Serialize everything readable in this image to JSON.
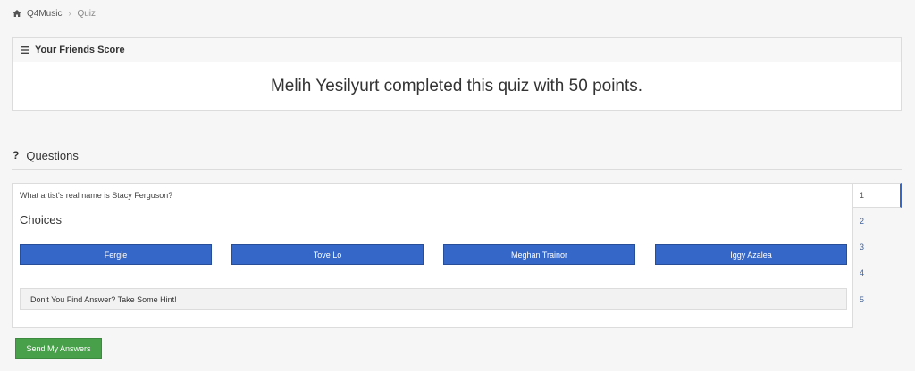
{
  "breadcrumb": {
    "home_label": "Q4Music",
    "separator": "›",
    "current_label": "Quiz"
  },
  "friends_score": {
    "header_title": "Your Friends Score",
    "message": "Melih Yesilyurt completed this quiz with 50 points."
  },
  "questions_section": {
    "icon_glyph": "?",
    "title": "Questions"
  },
  "question": {
    "text": "What artist's real name is Stacy Ferguson?",
    "choices_title": "Choices",
    "choices": [
      "Fergie",
      "Tove Lo",
      "Meghan Trainor",
      "Iggy Azalea"
    ],
    "hint_label": "Don't You Find Answer? Take Some Hint!"
  },
  "question_tabs": {
    "items": [
      "1",
      "2",
      "3",
      "4",
      "5"
    ],
    "active": "1"
  },
  "actions": {
    "send_label": "Send My Answers"
  },
  "colors": {
    "choice_button": "#3567c8",
    "send_button": "#48a04a",
    "active_tab_indicator": "#3567c8"
  },
  "icons": {
    "home": "home-icon",
    "panel_menu": "menu-icon",
    "questions": "question-mark-icon"
  }
}
